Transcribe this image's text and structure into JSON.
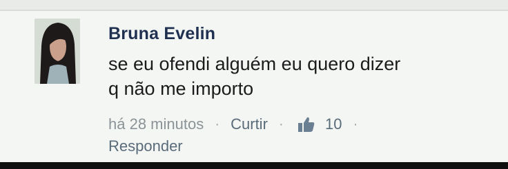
{
  "comment": {
    "author": "Bruna Evelin",
    "text_line1": "se eu ofendi alguém eu quero dizer",
    "text_line2": "q não me importo",
    "timestamp": "há 28 minutos",
    "separator": "·",
    "like_label": "Curtir",
    "like_count": "10",
    "reply_label": "Responder",
    "icons": {
      "like": "thumbs-up-icon"
    },
    "colors": {
      "author": "#1f3050",
      "meta": "#8b9396",
      "action": "#5a6b7a"
    }
  }
}
